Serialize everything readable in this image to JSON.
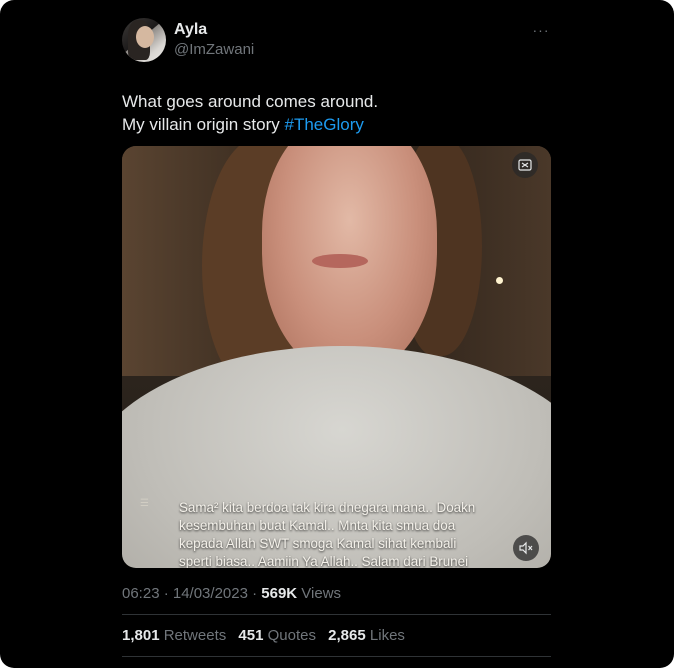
{
  "tweet": {
    "author_name": "Ayla",
    "author_handle": "@ImZawani",
    "more_label": "···",
    "text_line1": "What goes around comes around.",
    "text_line2_prefix": "My villain origin story ",
    "hashtag": "#TheGlory"
  },
  "media": {
    "caption": "Sama² kita berdoa tak kira dnegara mana.. Doakn\nkesembuhan buat Kamal.. Mnta kita smua doa\nkepada Allah SWT smoga Kamal sihat kembali\nsperti biasa.. Aamiin Ya Allah.. Salam dari Brunei",
    "top_icon": "gif-icon",
    "bottom_icon": "mute-icon"
  },
  "meta": {
    "time_date": "06:23 · 14/03/2023 · ",
    "views_count": "569K",
    "views_label": " Views"
  },
  "stats": {
    "retweets_count": "1,801",
    "retweets_label": "Retweets",
    "quotes_count": "451",
    "quotes_label": "Quotes",
    "likes_count": "2,865",
    "likes_label": "Likes"
  },
  "colors": {
    "background": "#000000",
    "text": "#e7e9ea",
    "secondary": "#71767b",
    "link": "#1d9bf0"
  }
}
